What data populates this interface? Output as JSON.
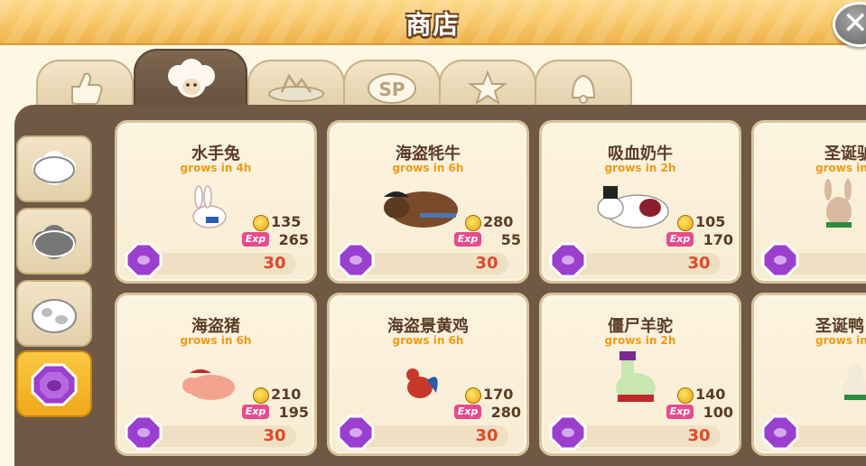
{
  "header": {
    "title": "商店",
    "close_icon": "close-icon"
  },
  "top_tabs": [
    {
      "icon": "thumbs-up-icon",
      "active": false
    },
    {
      "icon": "sheep-icon",
      "active": true
    },
    {
      "icon": "fence-icon",
      "active": false
    },
    {
      "icon": "sp-icon",
      "active": false
    },
    {
      "icon": "star-icon",
      "active": false
    },
    {
      "icon": "bell-icon",
      "active": false
    }
  ],
  "side_tabs": [
    {
      "icon": "white-sheep-icon",
      "active": false
    },
    {
      "icon": "gray-sheep-icon",
      "active": false
    },
    {
      "icon": "spotted-cow-icon",
      "active": false
    },
    {
      "icon": "purple-gem-icon",
      "active": true
    }
  ],
  "items": [
    {
      "name": "水手兔",
      "grow": "grows in 4h",
      "coins": "135",
      "exp_label": "Exp",
      "exp": "265",
      "price": "30"
    },
    {
      "name": "海盗牦牛",
      "grow": "grows in 6h",
      "coins": "280",
      "exp_label": "Exp",
      "exp": "55",
      "price": "30"
    },
    {
      "name": "吸血奶牛",
      "grow": "grows in 2h",
      "coins": "105",
      "exp_label": "Exp",
      "exp": "170",
      "price": "30"
    },
    {
      "name": "圣诞驴",
      "grow": "grows in",
      "coins": "",
      "exp_label": "",
      "exp": "",
      "price": ""
    },
    {
      "name": "海盗猪",
      "grow": "grows in 6h",
      "coins": "210",
      "exp_label": "Exp",
      "exp": "195",
      "price": "30"
    },
    {
      "name": "海盗景黄鸡",
      "grow": "grows in 6h",
      "coins": "170",
      "exp_label": "Exp",
      "exp": "280",
      "price": "30"
    },
    {
      "name": "僵尸羊驼",
      "grow": "grows in 2h",
      "coins": "140",
      "exp_label": "Exp",
      "exp": "100",
      "price": "30"
    },
    {
      "name": "圣诞鸭",
      "grow": "grows in",
      "coins": "",
      "exp_label": "",
      "exp": "",
      "price": ""
    }
  ],
  "colors": {
    "title_bar": "#f7c667",
    "board": "#6f5945",
    "card": "#fdf4e0",
    "name_text": "#5a3c26",
    "grow_text": "#f29a16",
    "price_text": "#e0492a",
    "exp_badge": "#e84a8f",
    "gem": "#9b3fcf",
    "active_side_tab": "#fbc842"
  }
}
